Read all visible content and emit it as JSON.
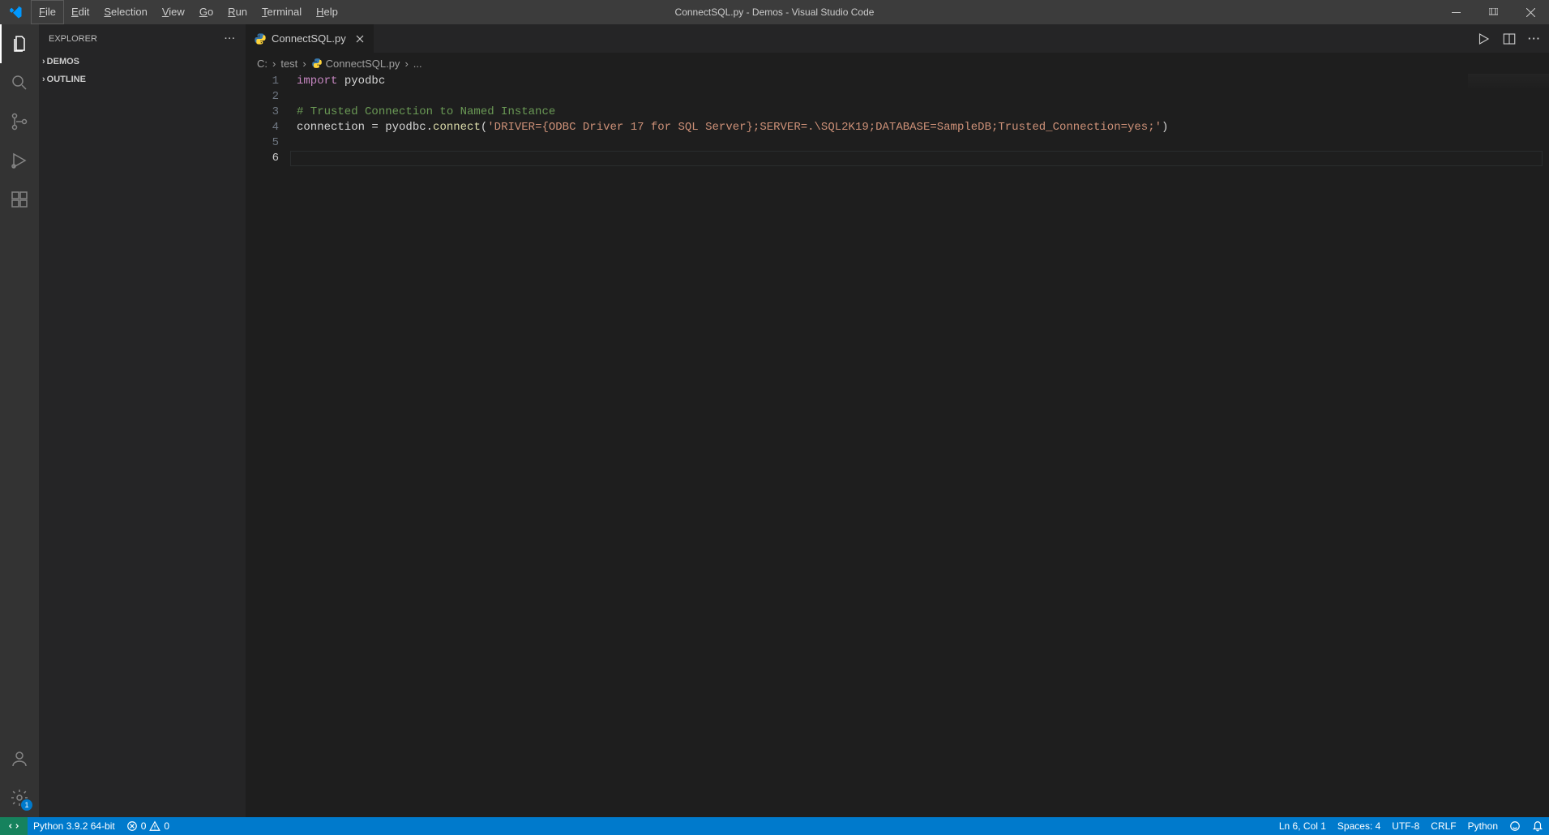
{
  "window": {
    "title": "ConnectSQL.py - Demos - Visual Studio Code"
  },
  "menu": [
    "File",
    "Edit",
    "Selection",
    "View",
    "Go",
    "Run",
    "Terminal",
    "Help"
  ],
  "sidebar": {
    "title": "EXPLORER",
    "sections": [
      "DEMOS",
      "OUTLINE"
    ]
  },
  "tab": {
    "filename": "ConnectSQL.py"
  },
  "breadcrumbs": {
    "drive": "C:",
    "folder": "test",
    "file": "ConnectSQL.py",
    "more": "..."
  },
  "code": {
    "line1_kw": "import",
    "line1_mod": " pyodbc",
    "line3_comment": "# Trusted Connection to Named Instance",
    "line4_a": "connection ",
    "line4_eq": "=",
    "line4_b": " pyodbc.",
    "line4_fn": "connect",
    "line4_p1": "(",
    "line4_str": "'DRIVER={ODBC Driver 17 for SQL Server};SERVER=.\\SQL2K19;DATABASE=SampleDB;Trusted_Connection=yes;'",
    "line4_p2": ")",
    "ln": [
      "1",
      "2",
      "3",
      "4",
      "5",
      "6"
    ]
  },
  "status": {
    "python": "Python 3.9.2 64-bit",
    "errors": "0",
    "warnings": "0",
    "cursor": "Ln 6, Col 1",
    "spaces": "Spaces: 4",
    "encoding": "UTF-8",
    "eol": "CRLF",
    "lang": "Python"
  },
  "settings_badge": "1"
}
